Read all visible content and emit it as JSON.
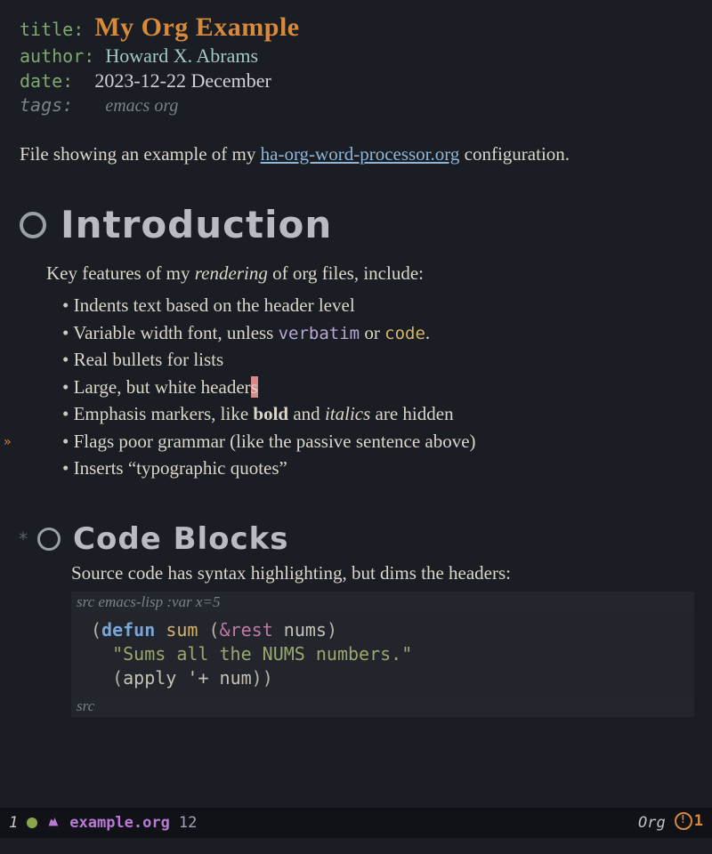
{
  "meta": {
    "title_key": "title",
    "title_val": "My Org Example",
    "author_key": "author",
    "author_val": "Howard X. Abrams",
    "date_key": "date",
    "date_val": "2023-12-22 December",
    "tags_key": "tags:",
    "tags_val": "emacs org"
  },
  "intro": {
    "before_link": "File showing an example of my ",
    "link_text": "ha-org-word-processor.org",
    "after_link": " configuration."
  },
  "h1": "Introduction",
  "features_lead_a": "Key features of my ",
  "features_lead_em": "rendering",
  "features_lead_b": " of org files, include:",
  "bullets": {
    "b0": "Indents text based on the header level",
    "b1a": "Variable width font, unless ",
    "b1_verb": "verbatim",
    "b1b": " or ",
    "b1_code": "code",
    "b1c": ".",
    "b2": "Real bullets for lists",
    "b3a": "Large, but white header",
    "b3_cursor": "s",
    "b4a": "Emphasis markers, like ",
    "b4_bold": "bold",
    "b4b": " and ",
    "b4_em": "italics",
    "b4c": " are hidden",
    "b5": "Flags poor grammar (like the passive sentence above)",
    "b6": "Inserts “typographic quotes”"
  },
  "h2_star": "*",
  "h2": "Code Blocks",
  "src_lead": "Source code has syntax highlighting, but dims the headers:",
  "src_header_a": "src ",
  "src_header_b": "emacs-lisp :var x=5",
  "code": {
    "l1_kw": "defun",
    "l1_fn": "sum",
    "l1_amp": "&rest",
    "l1_var": "nums",
    "l2_str": "\"Sums all the NUMS numbers.\"",
    "l3_apply": "apply",
    "l3_q": "'",
    "l3_plus": "+",
    "l3_arg": "num"
  },
  "src_footer": "src",
  "modeline": {
    "winnum": "1",
    "unicorn": "🦄",
    "filename": "example.org",
    "line": "12",
    "mode": "Org",
    "warn_sym": "ⓘ",
    "warn_count": "1"
  }
}
